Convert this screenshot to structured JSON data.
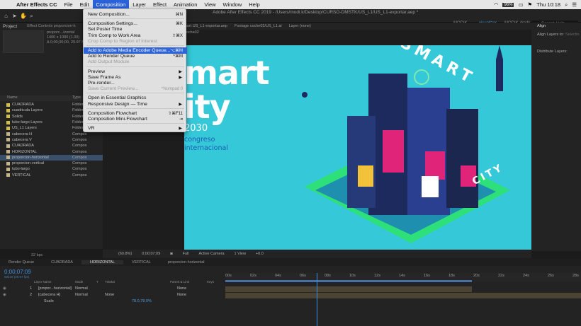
{
  "menubar": {
    "apple": "",
    "app": "After Effects CC",
    "items": [
      "File",
      "Edit",
      "Composition",
      "Layer",
      "Effect",
      "Animation",
      "View",
      "Window",
      "Help"
    ],
    "right": {
      "percent": "96%",
      "clock": "Thu 10:18"
    }
  },
  "toolbar": {
    "title": "Adobe After Effects CC 2019 - /Users/modi.k/Desktop/CURSO-DMSTK/US_L1/US_L1-exportar.aep *",
    "workspaces": [
      "MODIK",
      "visualizar",
      "MODIK-dmdk"
    ],
    "search_placeholder": "Search Help"
  },
  "project": {
    "tab": "Project",
    "effect_tab": "Effect Controls proporcion-h",
    "thumb_name": "proporc...izontal",
    "thumb_info": [
      "1400 x 1080 (1.00)",
      "Δ 0;00;30;00, 29.97 fps"
    ],
    "col_name": "Name",
    "col_type": "Type",
    "items": [
      {
        "name": "CUADRADA",
        "type": "Folder",
        "color": "#d2c04a"
      },
      {
        "name": "cuadricula Layers",
        "type": "Folder",
        "color": "#d2c04a"
      },
      {
        "name": "Solids",
        "type": "Folder",
        "color": "#d2c04a"
      },
      {
        "name": "tubo-largo Layers",
        "type": "Folder",
        "color": "#d2c04a"
      },
      {
        "name": "US_L1 Layers",
        "type": "Folder",
        "color": "#d2c04a"
      },
      {
        "name": "cabecera H",
        "type": "Compos",
        "color": "#c7b58a"
      },
      {
        "name": "cabecera V",
        "type": "Compos",
        "color": "#c7b58a"
      },
      {
        "name": "CUADRADA",
        "type": "Compos",
        "color": "#c7b58a"
      },
      {
        "name": "HORIZONTAL",
        "type": "Compos",
        "color": "#c7b58a"
      },
      {
        "name": "proporcion-horizontal",
        "type": "Compos",
        "color": "#c7b58a"
      },
      {
        "name": "proporcion-vertical",
        "type": "Compos",
        "color": "#c7b58a"
      },
      {
        "name": "tubo-largo",
        "type": "Compos",
        "color": "#c7b58a"
      },
      {
        "name": "VERTICAL",
        "type": "Compos",
        "color": "#c7b58a"
      }
    ],
    "bpc": "32 bpc"
  },
  "viewer": {
    "tabs": [
      "chart US_L1-exportar.aep",
      "Footage coche02/US_L1.ai",
      "Layer (none)"
    ],
    "sub_tab": "coche02",
    "art": {
      "line1": "mart",
      "line2": "ity",
      "year": "2030",
      "sub1": "congreso",
      "sub2": "internacional",
      "tower": "SMART",
      "city": "CITY"
    },
    "bottom": {
      "zoom": "(60.8%)",
      "timecode": "0;00;07;09",
      "quality": "Full",
      "camera": "Active Camera",
      "view": "1 View",
      "offset": "+0.0"
    }
  },
  "align": {
    "title": "Align",
    "align_to": "Align Layers to:",
    "selection": "Selectio",
    "distribute": "Distribute Layers:"
  },
  "menu": {
    "items": [
      {
        "label": "New Composition...",
        "shortcut": "⌘N"
      },
      {
        "sep": true
      },
      {
        "label": "Composition Settings...",
        "shortcut": "⌘K"
      },
      {
        "label": "Set Poster Time",
        "shortcut": ""
      },
      {
        "label": "Trim Comp to Work Area",
        "shortcut": "⇧⌘X"
      },
      {
        "label": "Crop Comp to Region of Interest",
        "shortcut": "",
        "disabled": true
      },
      {
        "sep": true
      },
      {
        "label": "Add to Adobe Media Encoder Queue...",
        "shortcut": "⌥⌘M",
        "highlight": true
      },
      {
        "label": "Add to Render Queue",
        "shortcut": "^⌘M"
      },
      {
        "label": "Add Output Module",
        "shortcut": "",
        "disabled": true
      },
      {
        "sep": true
      },
      {
        "label": "Preview",
        "shortcut": "",
        "arrow": true
      },
      {
        "label": "Save Frame As",
        "shortcut": "",
        "arrow": true
      },
      {
        "label": "Pre-render...",
        "shortcut": ""
      },
      {
        "label": "Save Current Preview...",
        "shortcut": "^Numpad 0",
        "disabled": true
      },
      {
        "sep": true
      },
      {
        "label": "Open in Essential Graphics",
        "shortcut": ""
      },
      {
        "label": "Responsive Design — Time",
        "shortcut": "",
        "arrow": true
      },
      {
        "sep": true
      },
      {
        "label": "Composition Flowchart",
        "shortcut": "⇧⌘F11"
      },
      {
        "label": "Composition Mini-Flowchart",
        "shortcut": "⇥"
      },
      {
        "sep": true
      },
      {
        "label": "VR",
        "shortcut": "",
        "arrow": true
      }
    ]
  },
  "timeline": {
    "tabs": [
      "Render Queue",
      "CUADRADA",
      "HORIZONTAL",
      "VERTICAL",
      "proporcion-horizontal"
    ],
    "active_tab": "HORIZONTAL",
    "timecode": "0;00;07;09",
    "timecode_sub": "00219 (29.97 fps)",
    "cols": [
      "Layer Name",
      "Mode",
      "T",
      "TrkMat",
      "Parent & Link",
      "Keys"
    ],
    "layers": [
      {
        "num": "1",
        "name": "[propor...horizontal]",
        "mode": "Normal",
        "trk": "",
        "parent": "None"
      },
      {
        "num": "2",
        "name": "[cabecera H]",
        "mode": "Normal",
        "trk": "None",
        "parent": "None"
      }
    ],
    "scale_label": "Scale",
    "scale_value": "78.0,78.0%",
    "ruler": [
      "00s",
      "02s",
      "04s",
      "06s",
      "08s",
      "10s",
      "12s",
      "14s",
      "16s",
      "18s",
      "20s",
      "22s",
      "24s",
      "26s",
      "28s"
    ]
  }
}
